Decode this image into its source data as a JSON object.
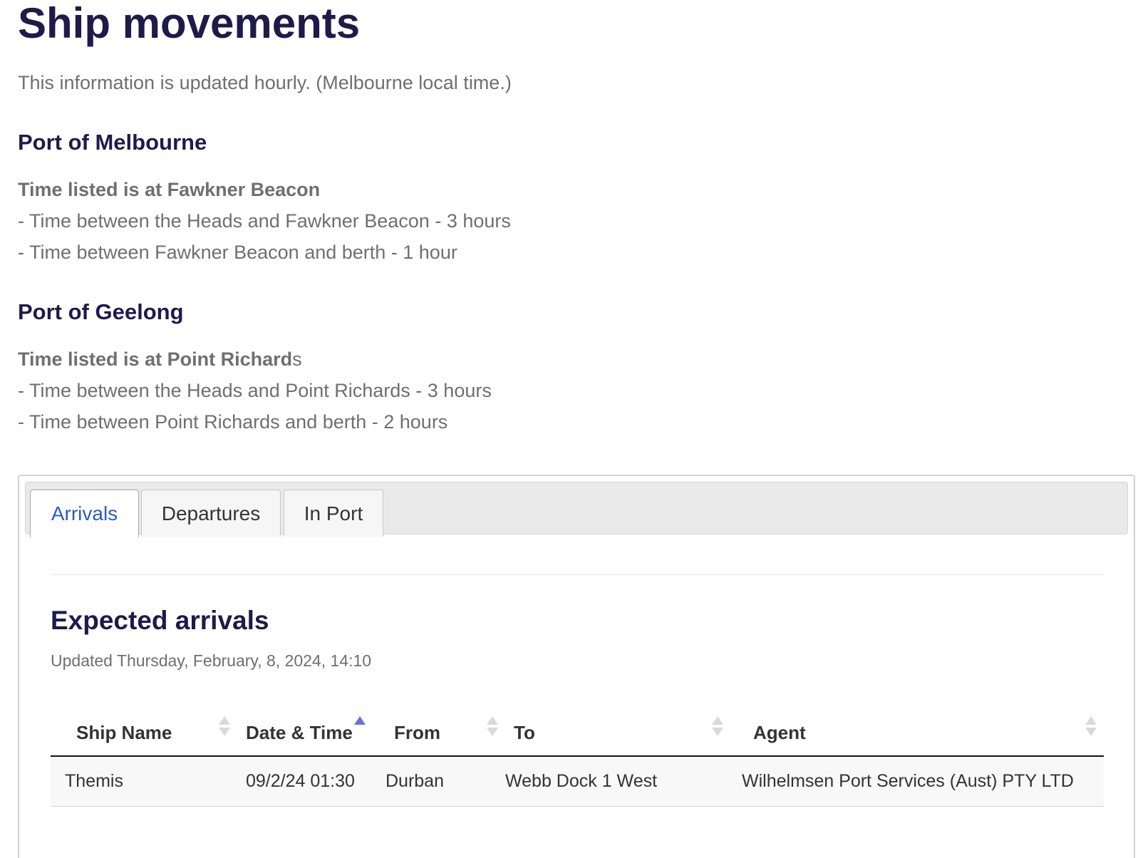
{
  "page": {
    "title": "Ship movements",
    "intro": "This information is updated hourly. (Melbourne local time.)"
  },
  "ports": [
    {
      "name": "Port of Melbourne",
      "subtitle": "Time listed is at Fawkner Beacon",
      "lines": [
        "- Time between the Heads and Fawkner Beacon - 3 hours",
        "- Time between Fawkner Beacon and berth - 1 hour"
      ]
    },
    {
      "name": "Port of Geelong",
      "subtitle_bold": "Time listed is at Point Richard",
      "subtitle_tail": "s",
      "lines": [
        "- Time between the Heads and Point Richards - 3 hours",
        "- Time between Point Richards and berth - 2 hours"
      ]
    }
  ],
  "tabs": [
    {
      "label": "Arrivals",
      "active": true
    },
    {
      "label": "Departures",
      "active": false
    },
    {
      "label": "In Port",
      "active": false
    }
  ],
  "arrivals": {
    "title": "Expected arrivals",
    "updated": "Updated Thursday, February, 8, 2024, 14:10",
    "columns": [
      "Ship Name",
      "Date & Time",
      "From",
      "To",
      "Agent"
    ],
    "sort": {
      "column": "Date & Time",
      "direction": "ascending"
    },
    "rows": [
      {
        "ship": "Themis",
        "datetime": "09/2/24 01:30",
        "from": "Durban",
        "to": "Webb Dock 1 West",
        "agent": "Wilhelmsen Port Services (Aust) PTY LTD"
      }
    ]
  },
  "colors": {
    "heading": "#1f1a4a",
    "body_text": "#6f6f72",
    "active_tab": "#2a5cbf",
    "sort_active": "#6b6fd6"
  },
  "icons": {
    "sort": "sort-arrows-icon",
    "sort_ascending": "sort-ascending-icon"
  }
}
